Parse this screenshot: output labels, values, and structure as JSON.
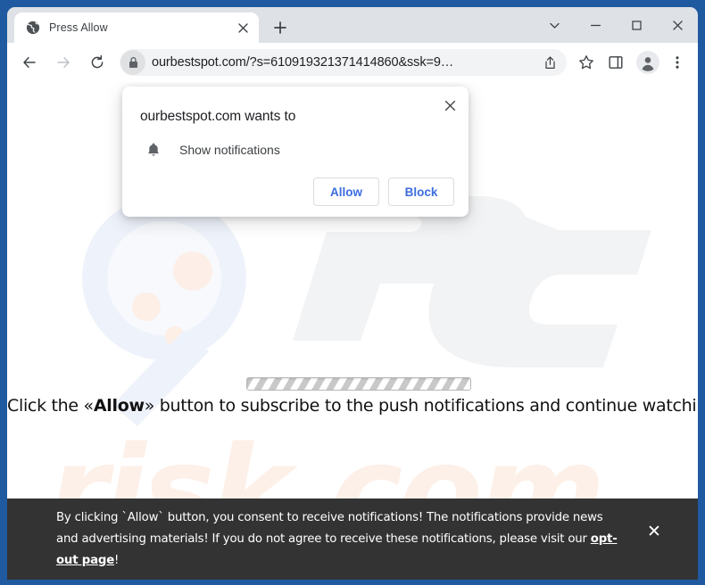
{
  "browser": {
    "window_controls": [
      {
        "name": "tab-search",
        "icon": "chevron-down-icon"
      },
      {
        "name": "minimize",
        "icon": "minimize-icon"
      },
      {
        "name": "maximize",
        "icon": "maximize-icon"
      },
      {
        "name": "close",
        "icon": "close-icon"
      }
    ],
    "tab": {
      "title": "Press Allow",
      "favicon": "globe-icon",
      "close_icon": "close-icon"
    },
    "new_tab_icon": "plus-icon",
    "navigation": {
      "back_icon": "arrow-left-icon",
      "forward_icon": "arrow-right-icon",
      "reload_icon": "reload-icon"
    },
    "omnibox": {
      "lock_icon": "lock-icon",
      "url": "ourbestspot.com/?s=610919321371414860&ssk=9…",
      "share_icon": "share-icon"
    },
    "toolbar_icons": [
      {
        "name": "bookmark-star-icon"
      },
      {
        "name": "side-panel-icon"
      },
      {
        "name": "profile-avatar-icon"
      },
      {
        "name": "browser-menu-icon"
      }
    ]
  },
  "permission_dialog": {
    "title": "ourbestspot.com wants to",
    "permission_icon": "bell-icon",
    "permission_label": "Show notifications",
    "allow_label": "Allow",
    "block_label": "Block",
    "close_icon": "close-icon",
    "accent_color": "#3c6ede"
  },
  "page": {
    "headline_prefix": "Click the «Allow»",
    "headline_before_bold": "Click the «",
    "headline_bold": "Allow",
    "headline_after_bold": "» button to subscribe to the push notifications and continue watching",
    "progress_bar_label": "loading-progress-bar",
    "watermark_text": "risk.com",
    "watermark_logo": "pc-logo-watermark",
    "watermark_color": "#fdf0e8"
  },
  "consent_banner": {
    "text_part1": "By clicking `Allow` button, you consent to receive notifications! The notifications provide news and advertising materials! If you do not agree to receive these notifications, please visit our ",
    "link_label": "opt-out page",
    "text_part2": "!",
    "close_label": "✕",
    "background_color": "#333333"
  }
}
